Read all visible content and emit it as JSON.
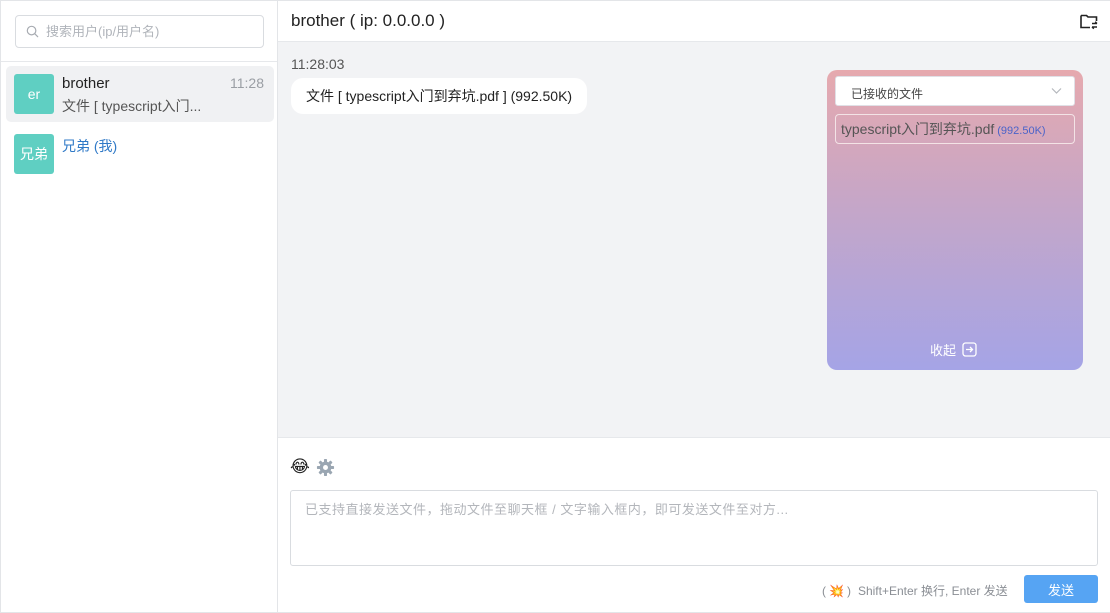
{
  "sidebar": {
    "search_placeholder": "搜索用户(ip/用户名)",
    "users": [
      {
        "avatar": "er",
        "name": "brother",
        "time": "11:28",
        "preview": "文件 [ typescript入门...",
        "active": true
      },
      {
        "avatar": "兄弟",
        "name": "兄弟 (我)",
        "time": "",
        "preview": "",
        "active": false
      }
    ]
  },
  "header": {
    "title": "brother ( ip: 0.0.0.0 )",
    "folder_icon": "folder-sync-icon"
  },
  "chat": {
    "messages": [
      {
        "time": "11:28:03",
        "text": "文件 [ typescript入门到弃坑.pdf ] (992.50K)"
      }
    ]
  },
  "files_panel": {
    "filter_selected": "已接收的文件",
    "files": [
      {
        "name": "typescript入门到弃坑.pdf",
        "size": "(992.50K)"
      }
    ],
    "collapse_label": "收起",
    "gradient_top": "#e6a9ae",
    "gradient_bottom": "#a5a4e6"
  },
  "composer": {
    "emoji": "😂",
    "placeholder": "已支持直接发送文件，拖动文件至聊天框 / 文字输入框内，即可发送文件至对方...",
    "hint_icon": "💥",
    "hint_text": "Shift+Enter 换行, Enter 发送",
    "send_label": "发送",
    "send_color": "#56a4f3"
  }
}
